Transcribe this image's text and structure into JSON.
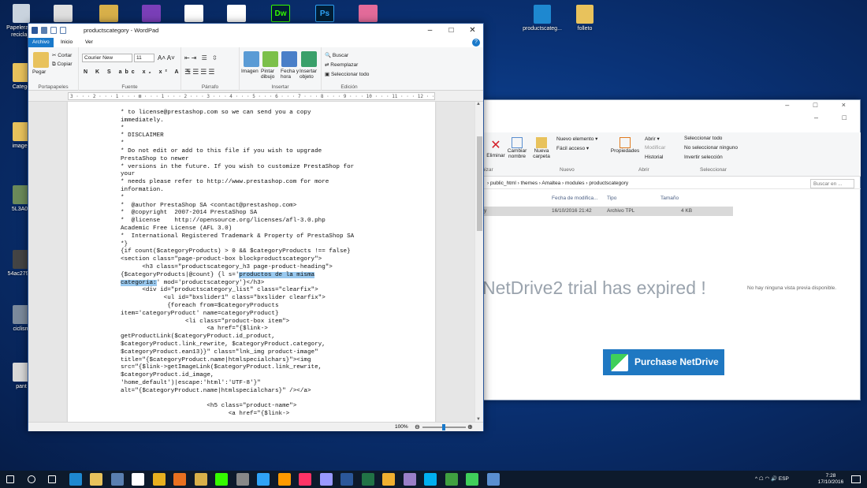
{
  "desktop": {
    "icons_left": [
      {
        "label": "Papelera de reciclaje",
        "icon": "recycle-bin-icon",
        "color": "#c9d3de"
      },
      {
        "label": "Catego",
        "icon": "folder-icon",
        "color": "#e8c25c"
      },
      {
        "label": "imagen",
        "icon": "image-file-icon",
        "color": "#e8c25c"
      },
      {
        "label": "5L3A08",
        "icon": "photo-icon",
        "color": "#6b8a5a"
      },
      {
        "label": "54ac27995",
        "icon": "photo-icon",
        "color": "#444444"
      },
      {
        "label": "ciclism",
        "icon": "photo-icon",
        "color": "#7b8a9c"
      },
      {
        "label": "pant",
        "icon": "image-file-icon",
        "color": "#d8d8d8"
      }
    ],
    "icons_top_right": [
      {
        "label": "productscateg...",
        "icon": "notepad-app-icon",
        "color": "#1e88d0"
      },
      {
        "label": "folleto",
        "icon": "folder-icon",
        "color": "#e8c25c"
      }
    ],
    "top_dock": [
      {
        "icon": "app-icon",
        "color": "#e0e0e0"
      },
      {
        "icon": "app-icon",
        "color": "#d8b04a"
      },
      {
        "icon": "visual-studio-icon",
        "color": "#7a3fb8"
      },
      {
        "icon": "app-icon",
        "color": "#ffffff"
      },
      {
        "icon": "app-icon",
        "color": "#ffffff"
      },
      {
        "icon": "dreamweaver-icon",
        "color": "#35fa00",
        "text": "Dw"
      },
      {
        "icon": "photoshop-icon",
        "color": "#2fa3f7",
        "text": "Ps"
      },
      {
        "icon": "app-icon",
        "color": "#e36b9a"
      }
    ]
  },
  "explorer": {
    "ribbon": {
      "eliminar": "Eliminar",
      "cambiar_nombre": "Cambiar nombre",
      "nueva_carpeta": "Nueva carpeta",
      "nuevo_elemento": "Nuevo elemento ▾",
      "facil_acceso": "Fácil acceso ▾",
      "propiedades": "Propiedades",
      "abrir": "Abrir ▾",
      "modificar": "Modificar",
      "historial": "Historial",
      "seleccionar_todo": "Seleccionar todo",
      "no_seleccionar": "No seleccionar ninguno",
      "invertir": "Invertir selección",
      "groups": {
        "organizar": "anizar",
        "nuevo": "Nuevo",
        "abrir": "Abrir",
        "seleccionar": "Seleccionar"
      }
    },
    "path": "› public_html › themes › Amaltea › modules › productscategory",
    "search_placeholder": "Buscar en ...",
    "columns": {
      "date": "Fecha de modifica...",
      "type": "Tipo",
      "size": "Tamaño"
    },
    "row": {
      "name": "y",
      "date": "16/10/2016 21:42",
      "type": "Archivo TPL",
      "size": "4 KB"
    },
    "preview_text": "No hay ninguna vista previa disponible.",
    "netdrive_message": "NetDrive2 trial has expired !",
    "purchase_button": "Purchase NetDrive !"
  },
  "wordpad": {
    "title": "productscategory - WordPad",
    "tabs": [
      "Archivo",
      "Inicio",
      "Ver"
    ],
    "clipboard": {
      "paste": "Pegar",
      "cut": "Cortar",
      "copy": "Copiar",
      "group": "Portapapeles"
    },
    "font": {
      "family": "Courier New",
      "size": "11",
      "group": "Fuente"
    },
    "paragraph_group": "Párrafo",
    "insert": {
      "image": "Imagen",
      "paint": "Pintar dibujo",
      "datetime": "Fecha y hora",
      "object": "Insertar objeto",
      "group": "Insertar"
    },
    "edit": {
      "find": "Buscar",
      "replace": "Reemplazar",
      "select_all": "Seleccionar todo",
      "group": "Edición"
    },
    "ruler": "3 · · · 2 · · · 1 · · · ⊠ · · · 1 · · · 2 · · · 3 · · · 4 · · · 5 · · · 6 · · · 7 · · · 8 · · · 9 · · · 10 · · · 11 · · · 12 · · · 13 · · · 14 · · · 15 · · · 16 · · · 17 · · · 18",
    "code_before": "* to license@prestashop.com so we can send you a copy\nimmediately.\n*\n* DISCLAIMER\n*\n* Do not edit or add to this file if you wish to upgrade\nPrestaShop to newer\n* versions in the future. If you wish to customize PrestaShop for\nyour\n* needs please refer to http://www.prestashop.com for more\ninformation.\n*\n*  @author PrestaShop SA <contact@prestashop.com>\n*  @copyright  2007-2014 PrestaShop SA\n*  @license    http://opensource.org/licenses/afl-3.0.php\nAcademic Free License (AFL 3.0)\n*  International Registered Trademark & Property of PrestaShop SA\n*}\n{if count($categoryProducts) > 0 && $categoryProducts !== false}\n<section class=\"page-product-box blockproductscategory\">\n      <h3 class=\"productscategory_h3 page-product-heading\">\n{$categoryProducts|@count} {l s='",
    "code_selected_1": "productos de la misma",
    "code_newline": "\n",
    "code_selected_2": "categoría:",
    "code_after": "' mod='productscategory'}</h3>\n      <div id=\"productscategory_list\" class=\"clearfix\">\n            <ul id=\"bxslider1\" class=\"bxslider clearfix\">\n             {foreach from=$categoryProducts\nitem='categoryProduct' name=categoryProduct}\n                  <li class=\"product-box item\">\n                        <a href=\"{$link->\ngetProductLink($categoryProduct.id_product,\n$categoryProduct.link_rewrite, $categoryProduct.category,\n$categoryProduct.ean13)}\" class=\"lnk_img product-image\"\ntitle=\"{$categoryProduct.name|htmlspecialchars}\"><img\nsrc=\"{$link->getImageLink($categoryProduct.link_rewrite,\n$categoryProduct.id_image,\n'home_default')|escape:'html':'UTF-8'}\"\nalt=\"{$categoryProduct.name|htmlspecialchars}\" /></a>\n\n                        <h5 class=\"product-name\">\n                              <a href=\"{$link->",
    "zoom": "100%"
  },
  "taskbar": {
    "apps": [
      {
        "icon": "start-icon",
        "color": "#ffffff"
      },
      {
        "icon": "cortana-icon",
        "color": "#ffffff"
      },
      {
        "icon": "task-view-icon",
        "color": "#ffffff"
      },
      {
        "icon": "edge-icon",
        "color": "#1e88d0"
      },
      {
        "icon": "file-explorer-icon",
        "color": "#e8c25c"
      },
      {
        "icon": "app-icon",
        "color": "#5a7fb0"
      },
      {
        "icon": "store-icon",
        "color": "#ffffff"
      },
      {
        "icon": "chrome-icon",
        "color": "#e8b020"
      },
      {
        "icon": "firefox-icon",
        "color": "#e87020"
      },
      {
        "icon": "app-icon",
        "color": "#d8b04a"
      },
      {
        "icon": "dreamweaver-icon",
        "color": "#35fa00"
      },
      {
        "icon": "app-icon",
        "color": "#888888"
      },
      {
        "icon": "photoshop-icon",
        "color": "#2fa3f7"
      },
      {
        "icon": "illustrator-icon",
        "color": "#ff9a00"
      },
      {
        "icon": "indesign-icon",
        "color": "#ff3366"
      },
      {
        "icon": "after-effects-icon",
        "color": "#9999ff"
      },
      {
        "icon": "word-icon",
        "color": "#2b579a"
      },
      {
        "icon": "excel-icon",
        "color": "#217346"
      },
      {
        "icon": "app-icon",
        "color": "#f0b030"
      },
      {
        "icon": "app-icon",
        "color": "#9a7fc8"
      },
      {
        "icon": "skype-icon",
        "color": "#00aff0"
      },
      {
        "icon": "app-icon",
        "color": "#40a040"
      },
      {
        "icon": "netdrive-icon",
        "color": "#3fcf5a"
      },
      {
        "icon": "wordpad-icon",
        "color": "#5a8fd0"
      }
    ],
    "tray_icons": "^ ☖ ◠ 🔊 ESP",
    "time": "7:28",
    "date": "17/10/2016"
  }
}
